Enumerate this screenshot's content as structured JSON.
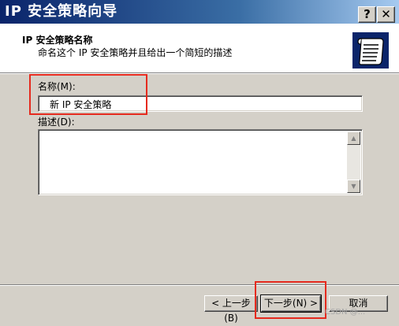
{
  "window": {
    "title": "IP 安全策略向导",
    "help_label": "?",
    "close_label": "✕"
  },
  "header": {
    "title": "IP 安全策略名称",
    "subtitle": "命名这个 IP 安全策略并且给出一个简短的描述",
    "icon": "policy-scroll-icon"
  },
  "form": {
    "name_label": "名称(M):",
    "name_value": "新 IP 安全策略",
    "description_label": "描述(D):",
    "description_value": ""
  },
  "buttons": {
    "back": "< 上一步(B)",
    "next": "下一步(N) >",
    "cancel": "取消"
  },
  "annotation_color": "#e52a1e",
  "watermark": "CSDN @..."
}
